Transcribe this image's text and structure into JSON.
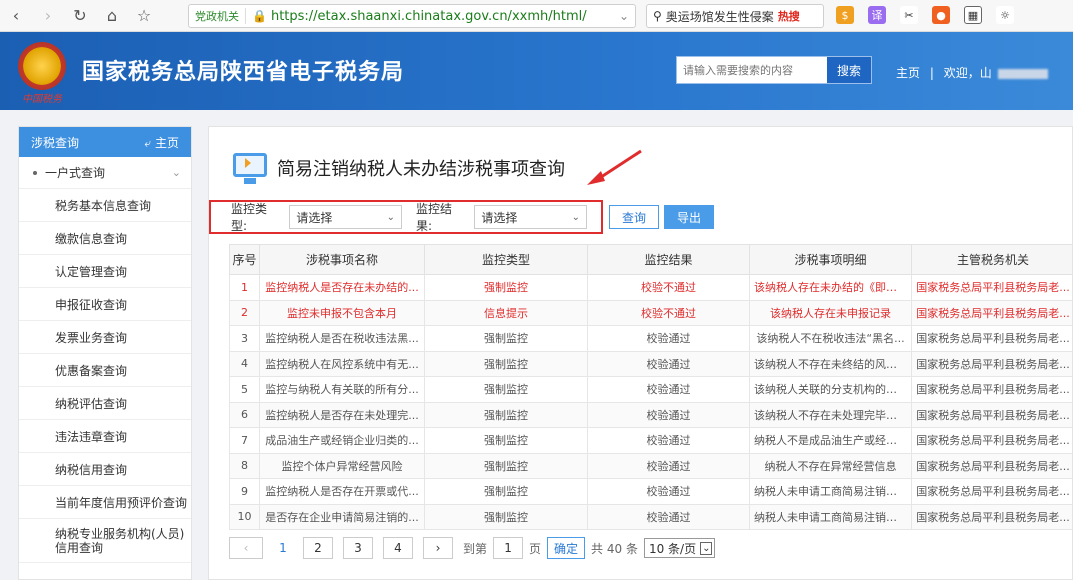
{
  "browser": {
    "gov_badge": "党政机关",
    "url": "https://etax.shaanxi.chinatax.gov.cn/xxmh/html/",
    "search_text": "奥运场馆发生性侵案",
    "search_hot": "热搜"
  },
  "header": {
    "title": "国家税务总局陕西省电子税务局",
    "emblem_text": "中国税务",
    "search_placeholder": "请输入需要搜索的内容",
    "search_button": "搜索",
    "home_link": "主页",
    "welcome": "欢迎，山"
  },
  "sidebar": {
    "head_title": "涉税查询",
    "head_home": "主页",
    "group": "一户式查询",
    "items": [
      "税务基本信息查询",
      "缴款信息查询",
      "认定管理查询",
      "申报征收查询",
      "发票业务查询",
      "优惠备案查询",
      "纳税评估查询",
      "违法违章查询",
      "纳税信用查询",
      "当前年度信用预评价查询",
      "纳税专业服务机构(人员)信用查询"
    ]
  },
  "main": {
    "title": "简易注销纳税人未办结涉税事项查询",
    "filter": {
      "type_label": "监控类型:",
      "type_value": "请选择",
      "result_label": "监控结果:",
      "result_value": "请选择"
    },
    "query_button": "查询",
    "export_button": "导出",
    "columns": [
      "序号",
      "涉税事项名称",
      "监控类型",
      "监控结果",
      "涉税事项明细",
      "主管税务机关"
    ],
    "rows": [
      [
        "1",
        "监控纳税人是否存在未办结的...",
        "强制监控",
        "校验不通过",
        "该纳税人存在未办结的《即办...",
        "国家税务总局平利县税务局老..."
      ],
      [
        "2",
        "监控未申报不包含本月",
        "信息提示",
        "校验不通过",
        "该纳税人存在未申报记录",
        "国家税务总局平利县税务局老..."
      ],
      [
        "3",
        "监控纳税人是否在税收违法黑...",
        "强制监控",
        "校验通过",
        "该纳税人不在税收违法“黑名...",
        "国家税务总局平利县税务局老..."
      ],
      [
        "4",
        "监控纳税人在风控系统中有无...",
        "强制监控",
        "校验通过",
        "该纳税人不存在未终结的风险...",
        "国家税务总局平利县税务局老..."
      ],
      [
        "5",
        "监控与纳税人有关联的所有分...",
        "强制监控",
        "校验通过",
        "该纳税人关联的分支机构的登...",
        "国家税务总局平利县税务局老..."
      ],
      [
        "6",
        "监控纳税人是否存在未处理完...",
        "强制监控",
        "校验通过",
        "该纳税人不存在未处理完毕的...",
        "国家税务总局平利县税务局老..."
      ],
      [
        "7",
        "成品油生产或经销企业归类的...",
        "强制监控",
        "校验通过",
        "纳税人不是成品油生产或经销...",
        "国家税务总局平利县税务局老..."
      ],
      [
        "8",
        "监控个体户异常经营风险",
        "强制监控",
        "校验通过",
        "纳税人不存在异常经营信息",
        "国家税务总局平利县税务局老..."
      ],
      [
        "9",
        "监控纳税人是否存在开票或代...",
        "强制监控",
        "校验通过",
        "纳税人未申请工商简易注销，...",
        "国家税务总局平利县税务局老..."
      ],
      [
        "10",
        "是否存在企业申请简易注销的...",
        "强制监控",
        "校验通过",
        "纳税人未申请工商简易注销，...",
        "国家税务总局平利县税务局老..."
      ]
    ],
    "red_rows": [
      0,
      1
    ],
    "pager": {
      "pages": [
        "1",
        "2",
        "3",
        "4"
      ],
      "goto_label": "到第",
      "goto_value": "1",
      "page_unit": "页",
      "ok": "确定",
      "total": "共 40 条",
      "size": "10 条/页"
    }
  }
}
